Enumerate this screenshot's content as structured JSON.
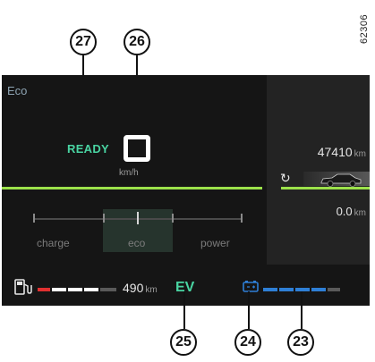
{
  "reference_code": "62306",
  "callouts": {
    "c27": "27",
    "c26": "26",
    "c25": "25",
    "c24": "24",
    "c23": "23"
  },
  "cluster": {
    "drive_mode": "Eco",
    "ready_text": "READY",
    "speed_unit": "km/h",
    "odometer_value": "47410",
    "odometer_unit": "km",
    "trip_value": "0.0",
    "trip_unit": "km",
    "gauge": {
      "labels": [
        "charge",
        "eco",
        "power"
      ]
    },
    "fuel_range_value": "490",
    "fuel_range_unit": "km",
    "ev_indicator": "EV"
  },
  "icons": {
    "speed_display": "speed-digit-icon",
    "trip_reset": "refresh-icon",
    "vehicle": "car-icon",
    "fuel": "fuel-pump-icon",
    "traction_battery": "battery-icon"
  },
  "levels": {
    "fuel_segments_filled": 3,
    "fuel_segments_total": 5,
    "battery_segments_filled": 4,
    "battery_segments_total": 5
  },
  "colors": {
    "screen_bg": "#151515",
    "accent_green": "#9be14a",
    "ready_teal": "#49d4a2",
    "battery_blue": "#2e7fd6",
    "fuel_low_red": "#e03030"
  }
}
